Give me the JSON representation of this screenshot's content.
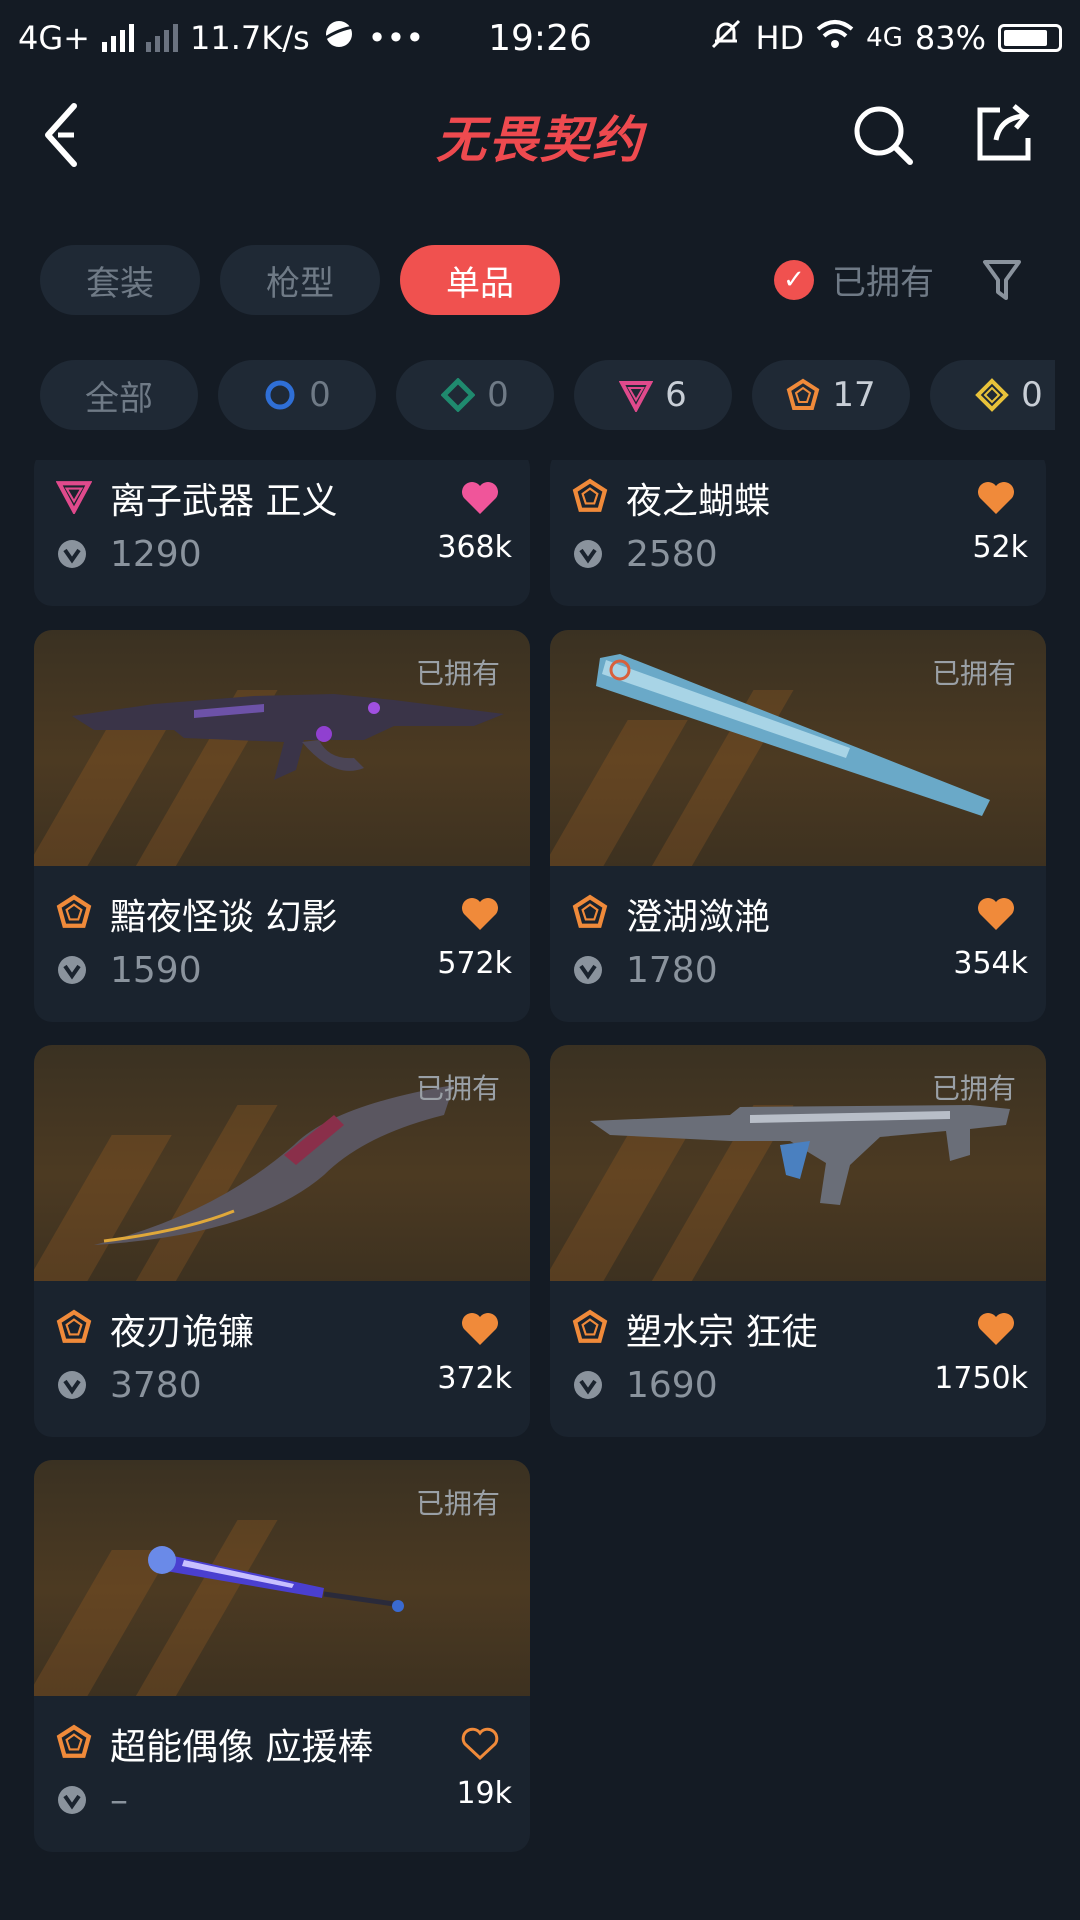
{
  "status_bar": {
    "network": "4G+",
    "speed": "11.7K/s",
    "dots": "•••",
    "time": "19:26",
    "hd": "HD",
    "wifi_network": "4G",
    "battery": "83%",
    "battery_level": 0.83
  },
  "header": {
    "title": "无畏契约"
  },
  "tabs": [
    {
      "label": "套装",
      "active": false
    },
    {
      "label": "枪型",
      "active": false
    },
    {
      "label": "单品",
      "active": true
    }
  ],
  "owned_filter": {
    "label": "已拥有",
    "checked": true
  },
  "chips": [
    {
      "label": "全部"
    },
    {
      "icon": "circle-tier-icon",
      "count": "0",
      "color": "#2f6fd6"
    },
    {
      "icon": "diamond-tier-icon",
      "count": "0",
      "color": "#1f8a6e"
    },
    {
      "icon": "triangle-tier-icon",
      "count": "6",
      "color": "#e04a8c"
    },
    {
      "icon": "pentagon-tier-icon",
      "count": "17",
      "color": "#f08a3a"
    },
    {
      "icon": "rhombus-tier-icon",
      "count": "0",
      "color": "#e8c23a"
    }
  ],
  "items": [
    {
      "name": "离子武器 正义",
      "tier": "triangle",
      "price": "1290",
      "likes": "368k",
      "liked": true,
      "heart_color": "#f0559a",
      "owned_tag": ""
    },
    {
      "name": "夜之蝴蝶",
      "tier": "pentagon",
      "price": "2580",
      "likes": "52k",
      "liked": true,
      "heart_color": "#f08a3a",
      "owned_tag": ""
    },
    {
      "name": "黯夜怪谈 幻影",
      "tier": "pentagon",
      "price": "1590",
      "likes": "572k",
      "liked": true,
      "heart_color": "#f08a3a",
      "owned_tag": "已拥有"
    },
    {
      "name": "澄湖潋滟",
      "tier": "pentagon",
      "price": "1780",
      "likes": "354k",
      "liked": true,
      "heart_color": "#f08a3a",
      "owned_tag": "已拥有"
    },
    {
      "name": "夜刃诡镰",
      "tier": "pentagon",
      "price": "3780",
      "likes": "372k",
      "liked": true,
      "heart_color": "#f08a3a",
      "owned_tag": "已拥有"
    },
    {
      "name": "塑水宗 狂徒",
      "tier": "pentagon",
      "price": "1690",
      "likes": "1750k",
      "liked": true,
      "heart_color": "#f08a3a",
      "owned_tag": "已拥有"
    },
    {
      "name": "超能偶像 应援棒",
      "tier": "pentagon",
      "price": "–",
      "likes": "19k",
      "liked": false,
      "heart_color": "#f08a3a",
      "owned_tag": "已拥有"
    }
  ],
  "colors": {
    "accent": "#f0514f",
    "background": "#141b24",
    "card": "#1a232e"
  }
}
